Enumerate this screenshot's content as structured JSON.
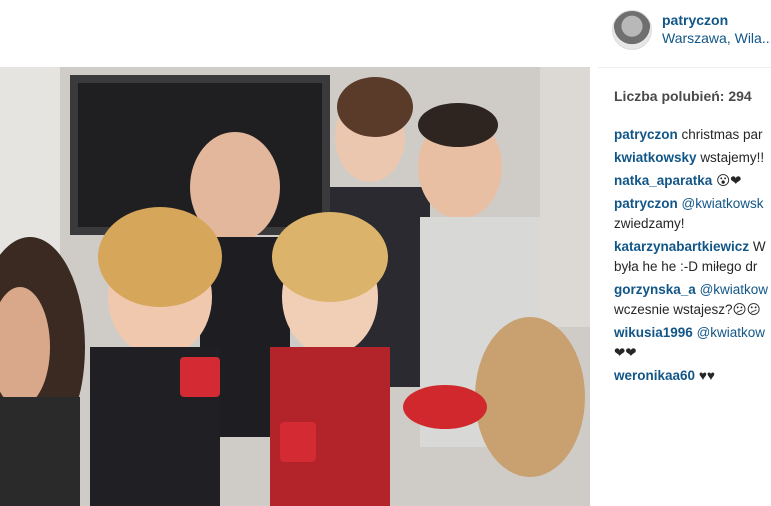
{
  "post": {
    "author": "patryczon",
    "location": "Warszawa, Wila...",
    "likes_text": "Liczba polubień: 294"
  },
  "comments": [
    {
      "user": "patryczon",
      "text": "christmas par"
    },
    {
      "user": "kwiatkowsky",
      "text": "wstajemy!!"
    },
    {
      "user": "natka_aparatka",
      "text": "😮❤"
    },
    {
      "user": "patryczon",
      "text": "@kwiatkowsk",
      "text2": "zwiedzamy!"
    },
    {
      "user": "katarzynabartkiewicz",
      "text": "W",
      "text2": "była he he :-D miłego dr"
    },
    {
      "user": "gorzynska_a",
      "text": "@kwiatkow",
      "text2": "wczesnie wstajesz?😕😕"
    },
    {
      "user": "wikusia1996",
      "text": "@kwiatkow",
      "text2": "❤❤"
    },
    {
      "user": "weronikaa60",
      "text": "♥♥"
    }
  ],
  "colors": {
    "link": "#125688",
    "text": "#262626",
    "muted": "#4a4a4a"
  }
}
